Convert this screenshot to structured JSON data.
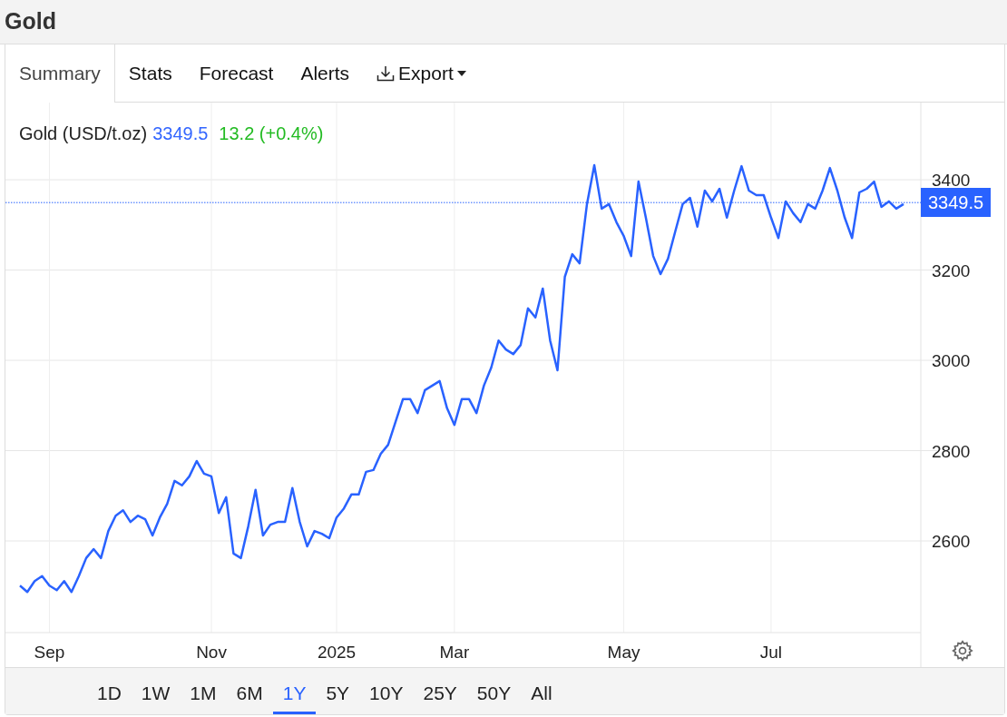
{
  "title": "Gold",
  "tabs": [
    {
      "label": "Summary",
      "selected": true,
      "kind": "tab"
    },
    {
      "label": "Stats",
      "selected": false,
      "kind": "tab"
    },
    {
      "label": "Forecast",
      "selected": false,
      "kind": "tab"
    },
    {
      "label": "Alerts",
      "selected": false,
      "kind": "tab"
    },
    {
      "label": "Export",
      "selected": false,
      "kind": "dropdown"
    }
  ],
  "legend": {
    "name": "Gold (USD/t.oz)",
    "price": "3349.5",
    "change": "13.2 (+0.4%)"
  },
  "chart_data": {
    "type": "line",
    "ylim": [
      2397,
      3571
    ],
    "grid": true,
    "ref_lines": [
      {
        "axis": "y",
        "value": 3349.5,
        "label": "3349.5"
      }
    ],
    "yticks": [
      2600,
      2800,
      3000,
      3200,
      3400
    ],
    "categories": [
      null,
      null,
      null,
      null,
      "Sep",
      null,
      null,
      null,
      null,
      null,
      null,
      null,
      null,
      null,
      null,
      null,
      null,
      null,
      null,
      null,
      null,
      null,
      null,
      null,
      null,
      null,
      "Nov",
      null,
      null,
      null,
      null,
      null,
      null,
      null,
      null,
      null,
      null,
      null,
      null,
      null,
      null,
      null,
      null,
      "2025",
      null,
      null,
      null,
      null,
      null,
      null,
      null,
      null,
      null,
      null,
      null,
      null,
      null,
      null,
      null,
      "Mar",
      null,
      null,
      null,
      null,
      null,
      null,
      null,
      null,
      null,
      null,
      null,
      null,
      null,
      null,
      null,
      null,
      null,
      null,
      null,
      null,
      null,
      null,
      "May",
      null,
      null,
      null,
      null,
      null,
      null,
      null,
      null,
      null,
      null,
      null,
      null,
      null,
      null,
      null,
      null,
      null,
      null,
      null,
      "Jul",
      null,
      null,
      null,
      null,
      null,
      null,
      null,
      null,
      null,
      null,
      null,
      null,
      null,
      null,
      null,
      null,
      null,
      null
    ],
    "series": [
      {
        "color": "#2962ff",
        "values": [
          2501,
          2487,
          2511,
          2522,
          2501,
          2491,
          2511,
          2487,
          2522,
          2562,
          2582,
          2562,
          2622,
          2656,
          2668,
          2642,
          2656,
          2648,
          2612,
          2652,
          2682,
          2733,
          2723,
          2743,
          2777,
          2749,
          2743,
          2662,
          2697,
          2572,
          2562,
          2632,
          2713,
          2612,
          2636,
          2642,
          2642,
          2717,
          2642,
          2588,
          2622,
          2616,
          2606,
          2652,
          2672,
          2703,
          2703,
          2753,
          2757,
          2793,
          2813,
          2863,
          2914,
          2914,
          2883,
          2934,
          2944,
          2954,
          2894,
          2857,
          2914,
          2914,
          2883,
          2944,
          2984,
          3044,
          3024,
          3014,
          3034,
          3115,
          3095,
          3159,
          3044,
          2978,
          3185,
          3235,
          3215,
          3346,
          3432,
          3336,
          3346,
          3306,
          3275,
          3231,
          3396,
          3316,
          3231,
          3191,
          3225,
          3286,
          3346,
          3360,
          3296,
          3376,
          3352,
          3380,
          3316,
          3376,
          3430,
          3376,
          3366,
          3366,
          3316,
          3271,
          3352,
          3326,
          3306,
          3346,
          3336,
          3376,
          3426,
          3376,
          3316,
          3271,
          3372,
          3380,
          3396,
          3340,
          3352,
          3336,
          3346
        ]
      }
    ]
  },
  "ranges": [
    {
      "label": "1D",
      "selected": false
    },
    {
      "label": "1W",
      "selected": false
    },
    {
      "label": "1M",
      "selected": false
    },
    {
      "label": "6M",
      "selected": false
    },
    {
      "label": "1Y",
      "selected": true
    },
    {
      "label": "5Y",
      "selected": false
    },
    {
      "label": "10Y",
      "selected": false
    },
    {
      "label": "25Y",
      "selected": false
    },
    {
      "label": "50Y",
      "selected": false
    },
    {
      "label": "All",
      "selected": false
    }
  ]
}
